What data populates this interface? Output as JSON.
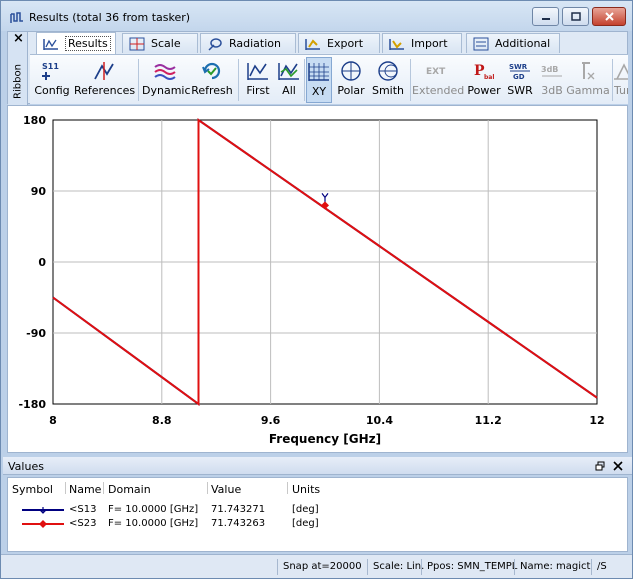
{
  "window": {
    "title": "Results (total 36 from tasker)"
  },
  "ribbon": {
    "side_label": "Ribbon",
    "tabs": [
      {
        "label": "Results",
        "icon": "results-tab-icon"
      },
      {
        "label": "Scale",
        "icon": "scale-tab-icon"
      },
      {
        "label": "Radiation",
        "icon": "radiation-tab-icon"
      },
      {
        "label": "Export",
        "icon": "export-tab-icon"
      },
      {
        "label": "Import",
        "icon": "import-tab-icon"
      },
      {
        "label": "Additional",
        "icon": "additional-tab-icon"
      }
    ],
    "tools": {
      "config": "Config",
      "config_icon_text": "S11",
      "references": "References",
      "dynamic": "Dynamic",
      "refresh": "Refresh",
      "first": "First",
      "all": "All",
      "xy": "XY",
      "polar": "Polar",
      "smith": "Smith",
      "extended": "Extended",
      "extended_icon_text": "EXT",
      "power": "Power",
      "power_icon_text": "P",
      "power_icon_sub": "bal",
      "swr": "SWR",
      "swr_icon_top": "SWR",
      "swr_icon_bottom": "GD",
      "db3": "3dB",
      "db3_icon_text": "3dB",
      "gamma": "Gamma",
      "tuning": "Tuning"
    }
  },
  "chart_data": {
    "type": "line",
    "xlabel": "Frequency [GHz]",
    "ylabel": "",
    "xlim": [
      8,
      12
    ],
    "ylim": [
      -180,
      180
    ],
    "x_ticks": [
      "8",
      "8.8",
      "9.6",
      "10.4",
      "11.2",
      "12"
    ],
    "y_ticks": [
      "180",
      "90",
      "0",
      "-90",
      "-180"
    ],
    "grid": true,
    "series": [
      {
        "name": "<S13",
        "color": "#000080",
        "x": [
          8,
          9.07,
          9.07,
          12
        ],
        "y": [
          -45,
          -180,
          180,
          -172
        ]
      },
      {
        "name": "<S23",
        "color": "#e01010",
        "x": [
          8,
          9.07,
          9.07,
          12
        ],
        "y": [
          -45,
          -180,
          180,
          -172
        ]
      }
    ],
    "markers": [
      {
        "series": "<S13",
        "x": 10,
        "y": 71.743271
      },
      {
        "series": "<S23",
        "x": 10,
        "y": 71.743263
      }
    ]
  },
  "values_panel": {
    "title": "Values",
    "columns": [
      "Symbol",
      "Name",
      "Domain",
      "Value",
      "Units"
    ],
    "rows": [
      {
        "name": "<S13",
        "domain": "F= 10.0000 [GHz]",
        "value": "71.743271",
        "units": "[deg]",
        "color": "#000080"
      },
      {
        "name": "<S23",
        "domain": "F= 10.0000 [GHz]",
        "value": "71.743263",
        "units": "[deg]",
        "color": "#e01010"
      }
    ]
  },
  "status": {
    "snap": "Snap at=20000",
    "scale": "Scale: Lin.",
    "ppos": "Ppos: SMN_TEMPL",
    "name": "Name: magict",
    "extra": "/S"
  }
}
